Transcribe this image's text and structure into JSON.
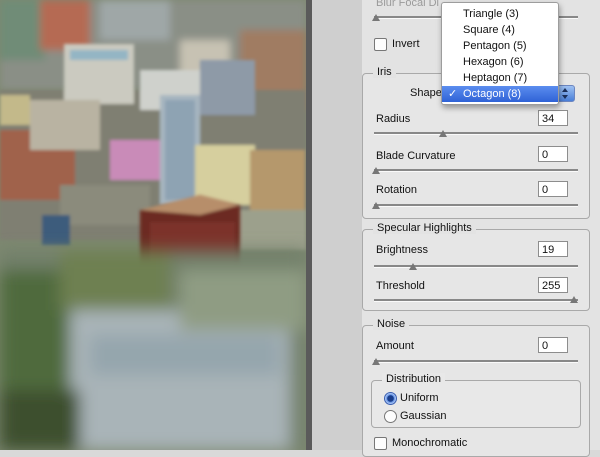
{
  "blur_focal": {
    "label": "Blur Focal Distance",
    "visible_text": "Blur Focal Di"
  },
  "invert": {
    "label": "Invert",
    "checked": false
  },
  "iris": {
    "group_label": "Iris",
    "shape_label": "Shape",
    "radius": {
      "label": "Radius",
      "value": "34"
    },
    "blade_curvature": {
      "label": "Blade Curvature",
      "value": "0"
    },
    "rotation": {
      "label": "Rotation",
      "value": "0"
    }
  },
  "shape_menu": {
    "items": [
      {
        "label": "Triangle (3)"
      },
      {
        "label": "Square (4)"
      },
      {
        "label": "Pentagon (5)"
      },
      {
        "label": "Hexagon (6)"
      },
      {
        "label": "Heptagon (7)"
      },
      {
        "label": "Octagon (8)",
        "selected": true
      }
    ],
    "check_mark": "✓"
  },
  "specular": {
    "group_label": "Specular Highlights",
    "brightness": {
      "label": "Brightness",
      "value": "19"
    },
    "threshold": {
      "label": "Threshold",
      "value": "255"
    }
  },
  "noise": {
    "group_label": "Noise",
    "amount": {
      "label": "Amount",
      "value": "0"
    },
    "distribution": {
      "group_label": "Distribution",
      "options": [
        {
          "label": "Uniform",
          "selected": true
        },
        {
          "label": "Gaussian",
          "selected": false
        }
      ]
    },
    "monochromatic": {
      "label": "Monochromatic",
      "checked": false
    }
  },
  "colors": {
    "selection": "#2f62d6",
    "panel": "#e3e3e3",
    "preview_divider": "#5a5a5a"
  }
}
